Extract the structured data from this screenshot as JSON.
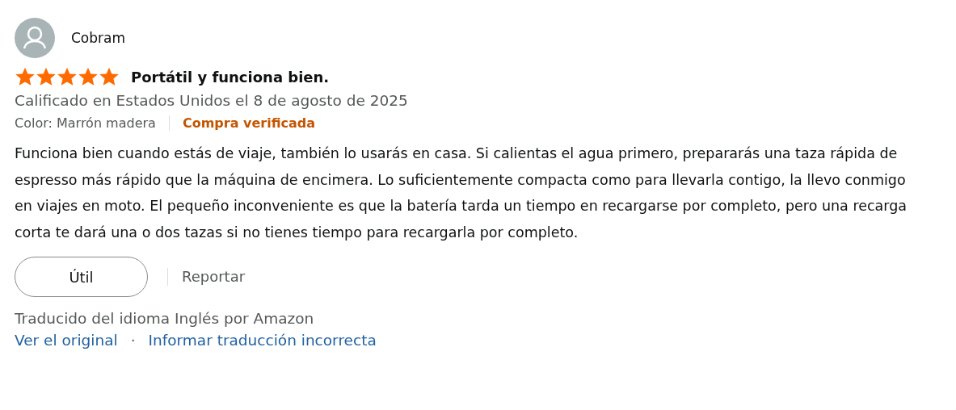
{
  "review": {
    "author": "Cobram",
    "stars": 5,
    "title": "Portátil y funciona bien.",
    "meta": "Calificado en Estados Unidos el 8 de agosto de 2025",
    "variant": "Color: Marrón madera",
    "badge": "Compra verificada",
    "body": "Funciona bien cuando estás de viaje, también lo usarás en casa. Si calientas el agua primero, prepararás una taza rápida de espresso más rápido que la máquina de encimera. Lo suficientemente compacta como para llevarla contigo, la llevo conmigo en viajes en moto. El pequeño inconveniente es que la batería tarda un tiempo en recargarse por completo, pero una recarga corta te dará una o dos tazas si no tienes tiempo para recargarla por completo.",
    "helpful_button": "Útil",
    "report_link": "Reportar",
    "translation_note": "Traducido del idioma Inglés por Amazon",
    "links": [
      "Ver el original",
      "Informar traducción incorrecta"
    ],
    "link_separator": "·"
  }
}
